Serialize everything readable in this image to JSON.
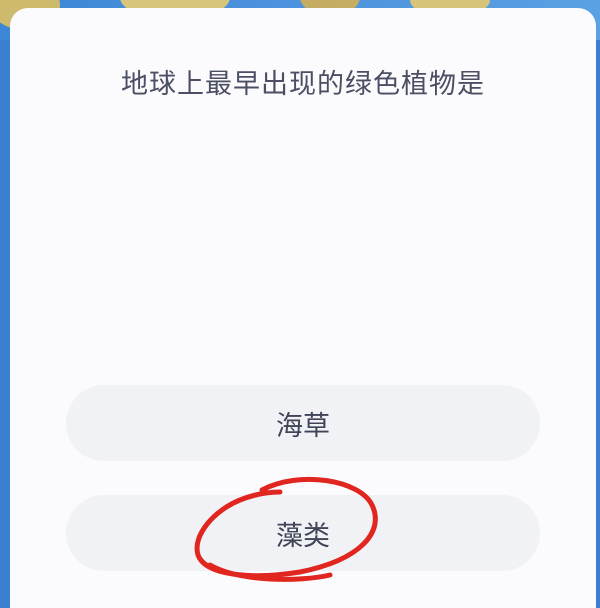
{
  "quiz": {
    "question": "地球上最早出现的绿色植物是",
    "options": [
      {
        "label": "海草"
      },
      {
        "label": "藻类"
      }
    ]
  },
  "colors": {
    "card_background": "#fbfbfd",
    "option_background": "#f1f2f6",
    "question_text": "#4a4f63",
    "annotation_stroke": "#e0261f"
  }
}
